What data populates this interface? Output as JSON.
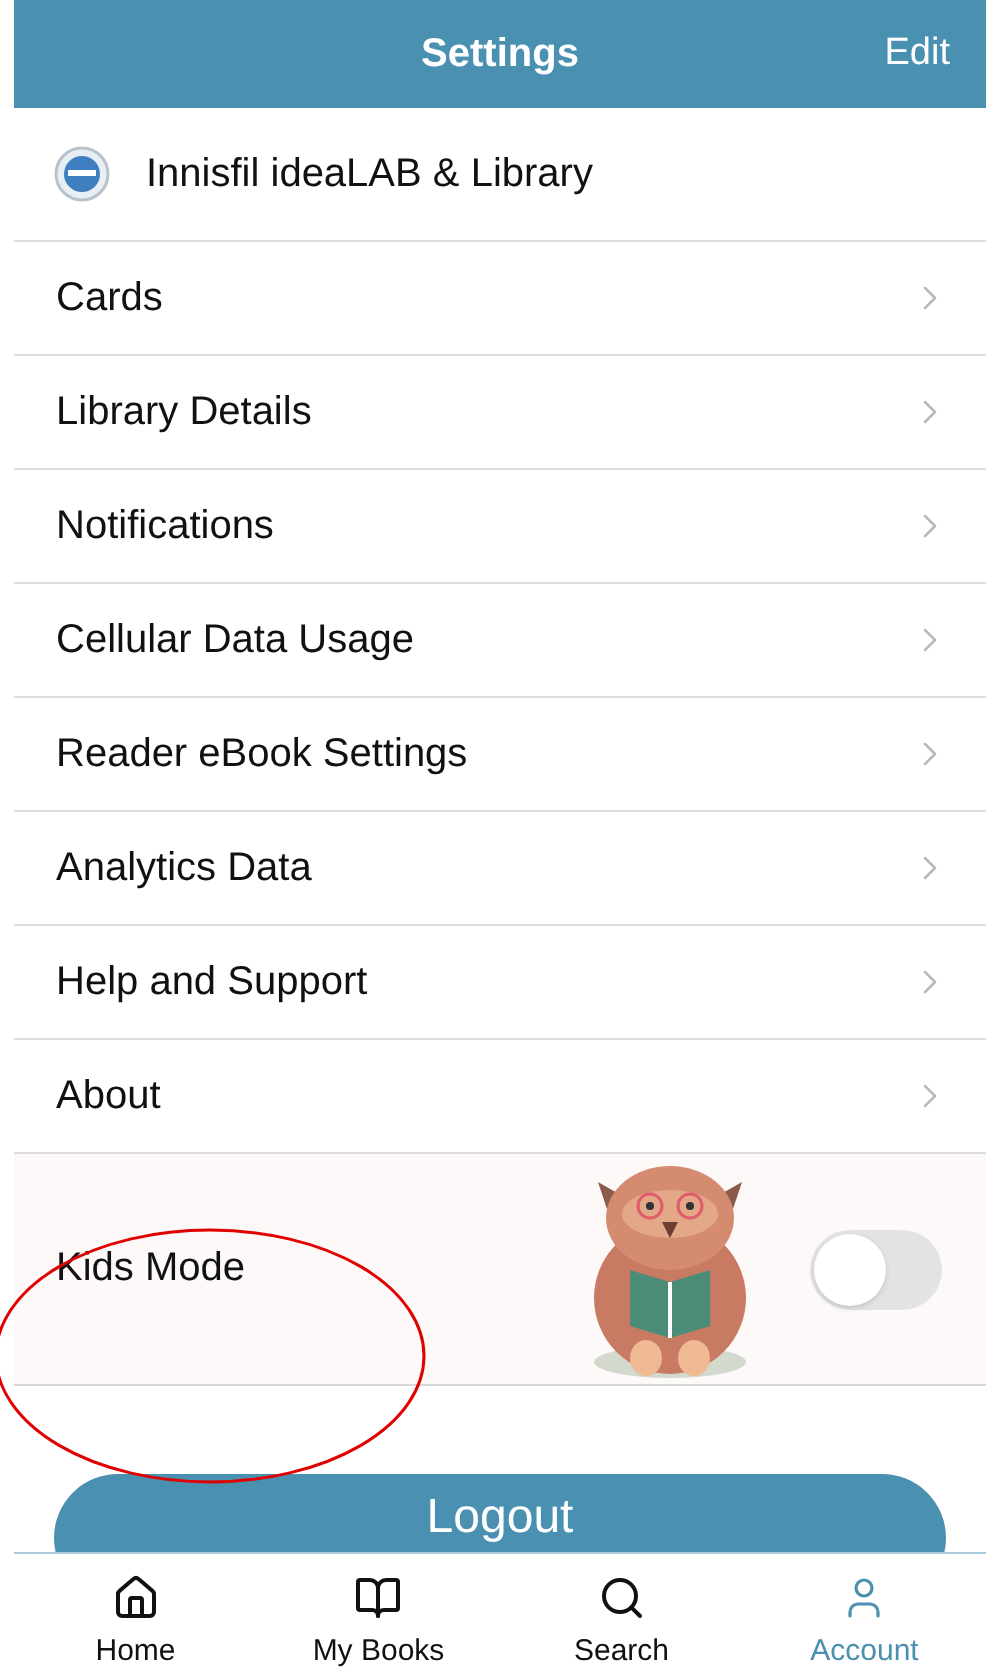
{
  "header": {
    "title": "Settings",
    "action": "Edit"
  },
  "library": {
    "name": "Innisfil ideaLAB & Library"
  },
  "menu": [
    {
      "label": "Cards"
    },
    {
      "label": "Library Details"
    },
    {
      "label": "Notifications"
    },
    {
      "label": "Cellular Data Usage"
    },
    {
      "label": "Reader eBook Settings"
    },
    {
      "label": "Analytics Data"
    },
    {
      "label": "Help and Support"
    },
    {
      "label": "About"
    }
  ],
  "kids_mode": {
    "label": "Kids Mode",
    "on": false
  },
  "logout": "Logout",
  "tabs": [
    {
      "label": "Home",
      "selected": false
    },
    {
      "label": "My Books",
      "selected": false
    },
    {
      "label": "Search",
      "selected": false
    },
    {
      "label": "Account",
      "selected": true
    }
  ]
}
